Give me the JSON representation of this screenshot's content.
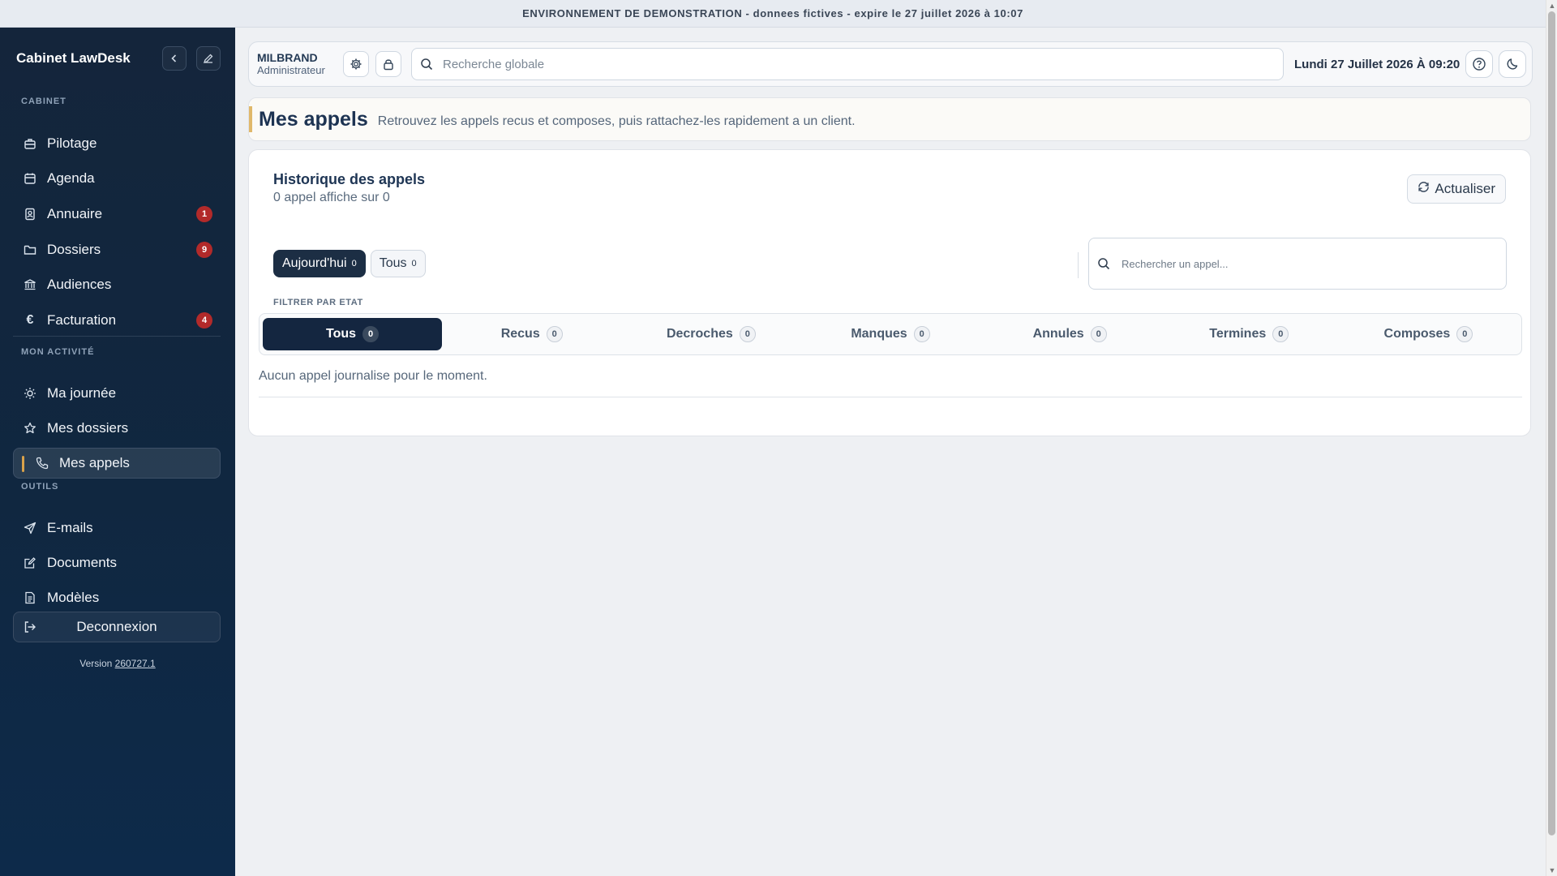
{
  "banner": {
    "text": "ENVIRONNEMENT DE DEMONSTRATION - donnees fictives - expire le 27 juillet 2026 à 10:07"
  },
  "sidebar": {
    "title": "Cabinet LawDesk",
    "sections": {
      "cabinet": "CABINET",
      "activity": "MON ACTIVITÉ",
      "tools": "OUTILS"
    },
    "items": [
      {
        "label": "Pilotage",
        "icon": "briefcase-icon"
      },
      {
        "label": "Agenda",
        "icon": "calendar-icon"
      },
      {
        "label": "Annuaire",
        "icon": "contact-book-icon",
        "badge": "1"
      },
      {
        "label": "Dossiers",
        "icon": "folder-icon",
        "badge": "9"
      },
      {
        "label": "Audiences",
        "icon": "courthouse-icon"
      },
      {
        "label": "Facturation",
        "icon": "euro-icon",
        "badge": "4"
      },
      {
        "label": "Ma journée",
        "icon": "sun-icon"
      },
      {
        "label": "Mes dossiers",
        "icon": "star-icon"
      },
      {
        "label": "Mes appels",
        "icon": "phone-icon",
        "active": true
      },
      {
        "label": "E-mails",
        "icon": "send-icon"
      },
      {
        "label": "Documents",
        "icon": "edit-document-icon"
      },
      {
        "label": "Modèles",
        "icon": "template-icon"
      }
    ],
    "logout_label": "Deconnexion",
    "version_prefix": "Version",
    "version_number": "260727.1"
  },
  "topbar": {
    "user_name": "MILBRAND",
    "user_role": "Administrateur",
    "search_placeholder": "Recherche globale",
    "date": "Lundi 27 Juillet 2026 À 09:20"
  },
  "page": {
    "title": "Mes appels",
    "subtitle": "Retrouvez les appels recus et composes, puis rattachez-les rapidement a un client."
  },
  "history": {
    "title": "Historique des appels",
    "count_text": "0 appel affiche sur 0",
    "refresh_label": "Actualiser",
    "period_tabs": [
      {
        "label": "Aujourd'hui",
        "count": "0",
        "active": true
      },
      {
        "label": "Tous",
        "count": "0"
      }
    ],
    "search_placeholder": "Rechercher un appel...",
    "filter_label": "FILTRER PAR ETAT",
    "state_tabs": [
      {
        "label": "Tous",
        "count": "0",
        "active": true
      },
      {
        "label": "Recus",
        "count": "0"
      },
      {
        "label": "Decroches",
        "count": "0"
      },
      {
        "label": "Manques",
        "count": "0"
      },
      {
        "label": "Annules",
        "count": "0"
      },
      {
        "label": "Termines",
        "count": "0"
      },
      {
        "label": "Composes",
        "count": "0"
      }
    ],
    "empty_message": "Aucun appel journalise pour le moment."
  },
  "colors": {
    "sidebar_bg": "#102740",
    "accent_gold": "#d9a24a",
    "badge_red": "#b22a2a",
    "active_tab": "#142640"
  }
}
